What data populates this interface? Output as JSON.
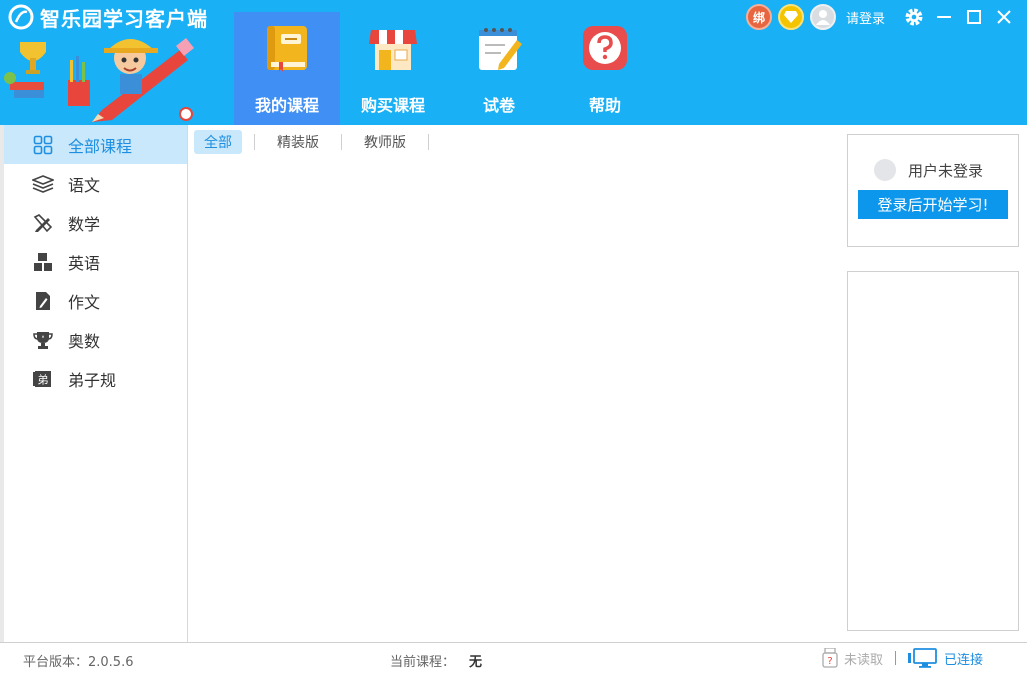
{
  "app": {
    "title": "智乐园学习客户端"
  },
  "nav": {
    "tabs": [
      {
        "label": "我的课程",
        "icon": "book-icon"
      },
      {
        "label": "购买课程",
        "icon": "shop-icon"
      },
      {
        "label": "试卷",
        "icon": "notepad-icon"
      },
      {
        "label": "帮助",
        "icon": "question-icon"
      }
    ]
  },
  "header": {
    "bind_badge": "绑",
    "login_link": "请登录"
  },
  "sidebar": {
    "items": [
      {
        "label": "全部课程",
        "icon": "grid-icon"
      },
      {
        "label": "语文",
        "icon": "books-stack-icon"
      },
      {
        "label": "数学",
        "icon": "pencil-ruler-icon"
      },
      {
        "label": "英语",
        "icon": "abc-blocks-icon"
      },
      {
        "label": "作文",
        "icon": "pen-document-icon"
      },
      {
        "label": "奥数",
        "icon": "trophy-icon"
      },
      {
        "label": "弟子规",
        "icon": "scroll-icon"
      }
    ],
    "scroll_glyph": "弟"
  },
  "filters": {
    "items": [
      "全部",
      "精装版",
      "教师版"
    ]
  },
  "login_card": {
    "status": "用户未登录",
    "button": "登录后开始学习!"
  },
  "statusbar": {
    "version": "平台版本：2.0.5.6",
    "current_course_label": "当前课程：",
    "current_course_value": "无",
    "unread": "未读取",
    "connected": "已连接"
  },
  "colors": {
    "header_bg": "#1ab0f5",
    "active_tab": "#3f8ff5",
    "accent": "#1e8fe0",
    "button": "#0d97ec"
  }
}
